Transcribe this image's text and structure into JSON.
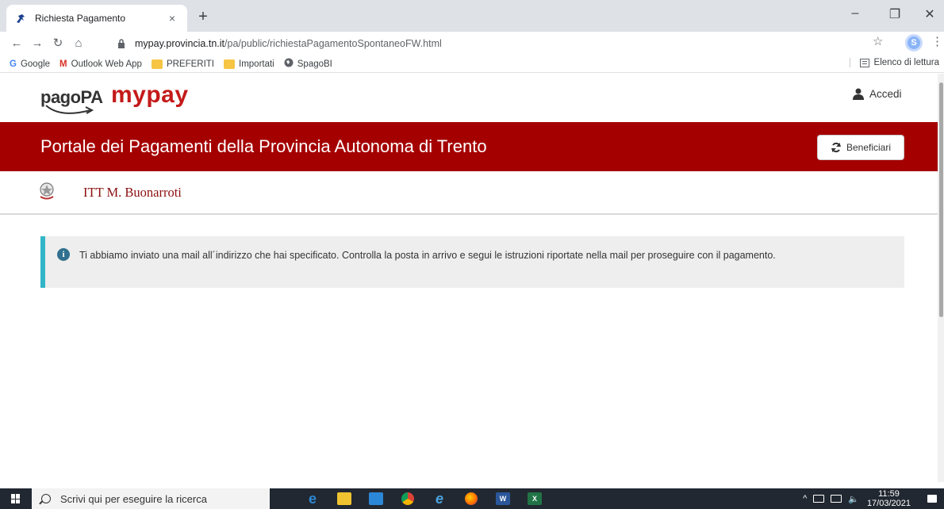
{
  "browser": {
    "tab_title": "Richiesta Pagamento",
    "tab_close": "×",
    "new_tab": "+",
    "url_host": "mypay.provincia.tn.it",
    "url_path": "/pa/public/richiestaPagamentoSpontaneoFW.html",
    "profile_initial": "S",
    "bookmarks": [
      "Google",
      "Outlook Web App",
      "PREFERITI",
      "Importati",
      "SpagoBI"
    ],
    "reading_list": "Elenco di lettura"
  },
  "header": {
    "logo_pagopa": "pagoPA",
    "logo_mypay": "mypay",
    "login_label": "Accedi"
  },
  "banner": {
    "title": "Portale dei Pagamenti della Provincia Autonoma di Trento",
    "button_label": "Beneficiari"
  },
  "entity": {
    "name": "ITT M. Buonarroti"
  },
  "alert": {
    "message": "Ti abbiamo inviato una mail all´indirizzo che hai specificato. Controlla la posta in arrivo e segui le istruzioni riportate nella mail per proseguire con il pagamento."
  },
  "taskbar": {
    "search_placeholder": "Scrivi qui per eseguire la ricerca",
    "time": "11:59",
    "date": "17/03/2021",
    "app_icons": [
      "edge-legacy-icon",
      "file-explorer-icon",
      "store-icon",
      "chrome-icon",
      "internet-explorer-icon",
      "firefox-icon",
      "word-icon",
      "excel-icon"
    ]
  },
  "colors": {
    "brand_red": "#a50000",
    "alert_accent": "#31b6c8",
    "entity_name": "#8b0e0e"
  }
}
